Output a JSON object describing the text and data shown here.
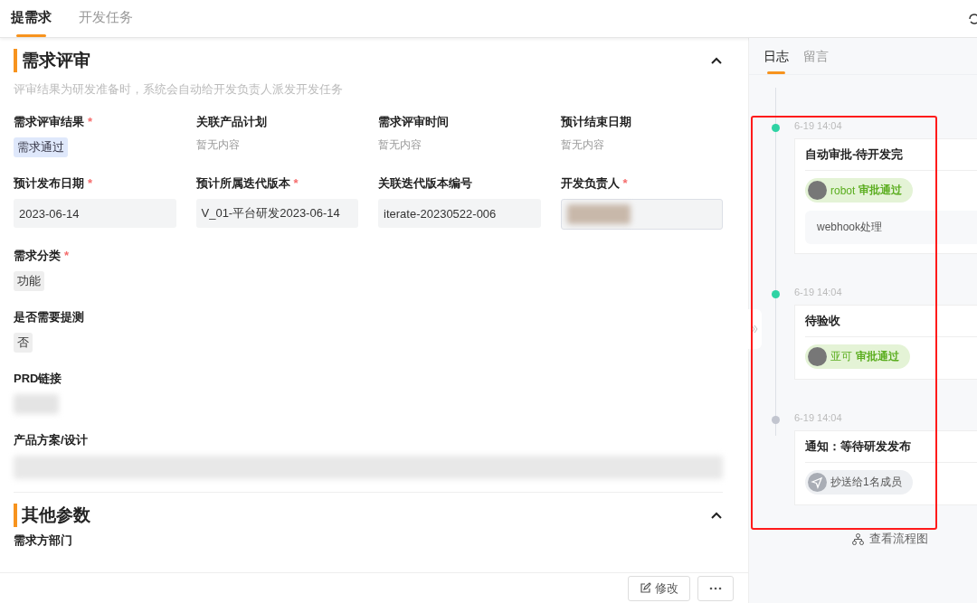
{
  "tabs": [
    {
      "label": "提需求",
      "selected": true
    },
    {
      "label": "开发任务",
      "selected": false
    }
  ],
  "sections": [
    {
      "title": "需求评审",
      "expanded": true,
      "hint": "评审结果为研发准备时，系统会自动给开发负责人派发开发任务",
      "grid": [
        {
          "label": "需求评审结果",
          "mark": "*",
          "kind": "tag",
          "value": "需求通过"
        },
        {
          "label": "关联产品计划",
          "kind": "empty",
          "value": "暂无内容"
        },
        {
          "label": "需求评审时间",
          "kind": "empty",
          "value": "暂无内容"
        },
        {
          "label": "预计结束日期",
          "kind": "empty",
          "value": "暂无内容"
        },
        {
          "label": "预计发布日期",
          "mark": "*",
          "kind": "input",
          "value": "2023-06-14"
        },
        {
          "label": "预计所属迭代版本",
          "mark": "*",
          "kind": "input",
          "value": "V_01-平台研发2023-06-14"
        },
        {
          "label": "关联迭代版本编号",
          "kind": "input",
          "value": "iterate-20230522-006"
        },
        {
          "label": "开发负责人",
          "mark": "*",
          "kind": "person"
        }
      ],
      "rows": [
        {
          "label": "需求分类",
          "mark": "*",
          "kind": "chip",
          "value": "功能"
        },
        {
          "label": "是否需要提测",
          "kind": "chip",
          "value": "否"
        },
        {
          "label": "PRD链接",
          "kind": "redacted-link"
        },
        {
          "label": "产品方案/设计",
          "kind": "redacted-bar"
        }
      ]
    },
    {
      "title": "其他参数",
      "expanded": true,
      "rows": [
        {
          "label": "需求方部门",
          "kind": "none"
        }
      ]
    }
  ],
  "footer": {
    "edit_button": "修改"
  },
  "side": {
    "tabs": [
      {
        "label": "日志",
        "selected": true
      },
      {
        "label": "留言",
        "selected": false
      }
    ],
    "log": [
      {
        "time": "6-19 14:04",
        "color": "#2fd3a4",
        "title": "自动审批-待开发完",
        "badge": {
          "kind": "approval",
          "user": "robot",
          "action": "审批通过"
        },
        "note": "webhook处理"
      },
      {
        "time": "6-19 14:04",
        "color": "#2fd3a4",
        "title": "待验收",
        "badge": {
          "kind": "approval",
          "user": "亚可",
          "action": "审批通过"
        }
      },
      {
        "time": "6-19 14:04",
        "color": "#c2c5cf",
        "title": "通知：等待研发发布",
        "badge": {
          "kind": "cc",
          "text": "抄送给1名成员"
        }
      }
    ],
    "flow_link": "查看流程图"
  }
}
